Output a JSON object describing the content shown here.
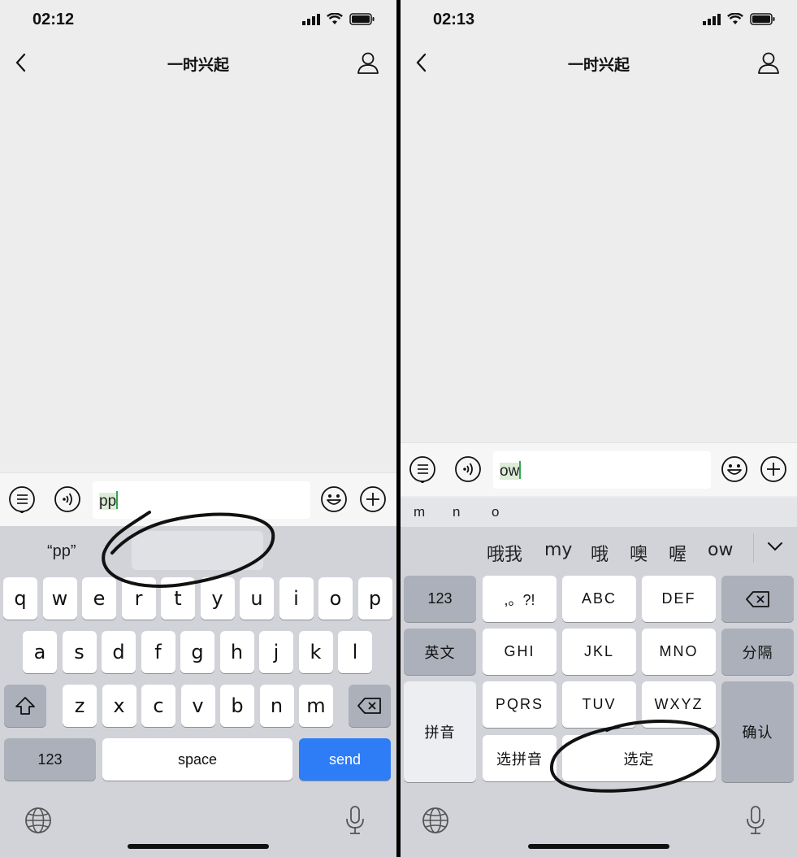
{
  "left": {
    "status": {
      "time": "02:12"
    },
    "nav": {
      "title": "一时兴起"
    },
    "input": {
      "value": "pp"
    },
    "keyboard": {
      "suggestion": "“pp”",
      "row1": [
        "q",
        "w",
        "e",
        "r",
        "t",
        "y",
        "u",
        "i",
        "o",
        "p"
      ],
      "row2": [
        "a",
        "s",
        "d",
        "f",
        "g",
        "h",
        "j",
        "k",
        "l"
      ],
      "row3": [
        "z",
        "x",
        "c",
        "v",
        "b",
        "n",
        "m"
      ],
      "numbers_label": "123",
      "space_label": "space",
      "send_label": "send"
    }
  },
  "right": {
    "status": {
      "time": "02:13"
    },
    "nav": {
      "title": "一时兴起"
    },
    "input": {
      "value": "ow"
    },
    "pinyin_options": [
      "m",
      "n",
      "o"
    ],
    "candidates": [
      "哦我",
      "my",
      "哦",
      "噢",
      "喔",
      "ow"
    ],
    "keyboard": {
      "numbers_label": "123",
      "punct_label": ",。?!",
      "abc_label": "ABC",
      "def_label": "DEF",
      "english_label": "英文",
      "ghi_label": "GHI",
      "jkl_label": "JKL",
      "mno_label": "MNO",
      "separator_label": "分隔",
      "pinyin_label": "拼音",
      "pqrs_label": "PQRS",
      "tuv_label": "TUV",
      "wxyz_label": "WXYZ",
      "confirm_label": "确认",
      "select_pinyin_label": "选拼音",
      "select_label": "选定"
    }
  }
}
